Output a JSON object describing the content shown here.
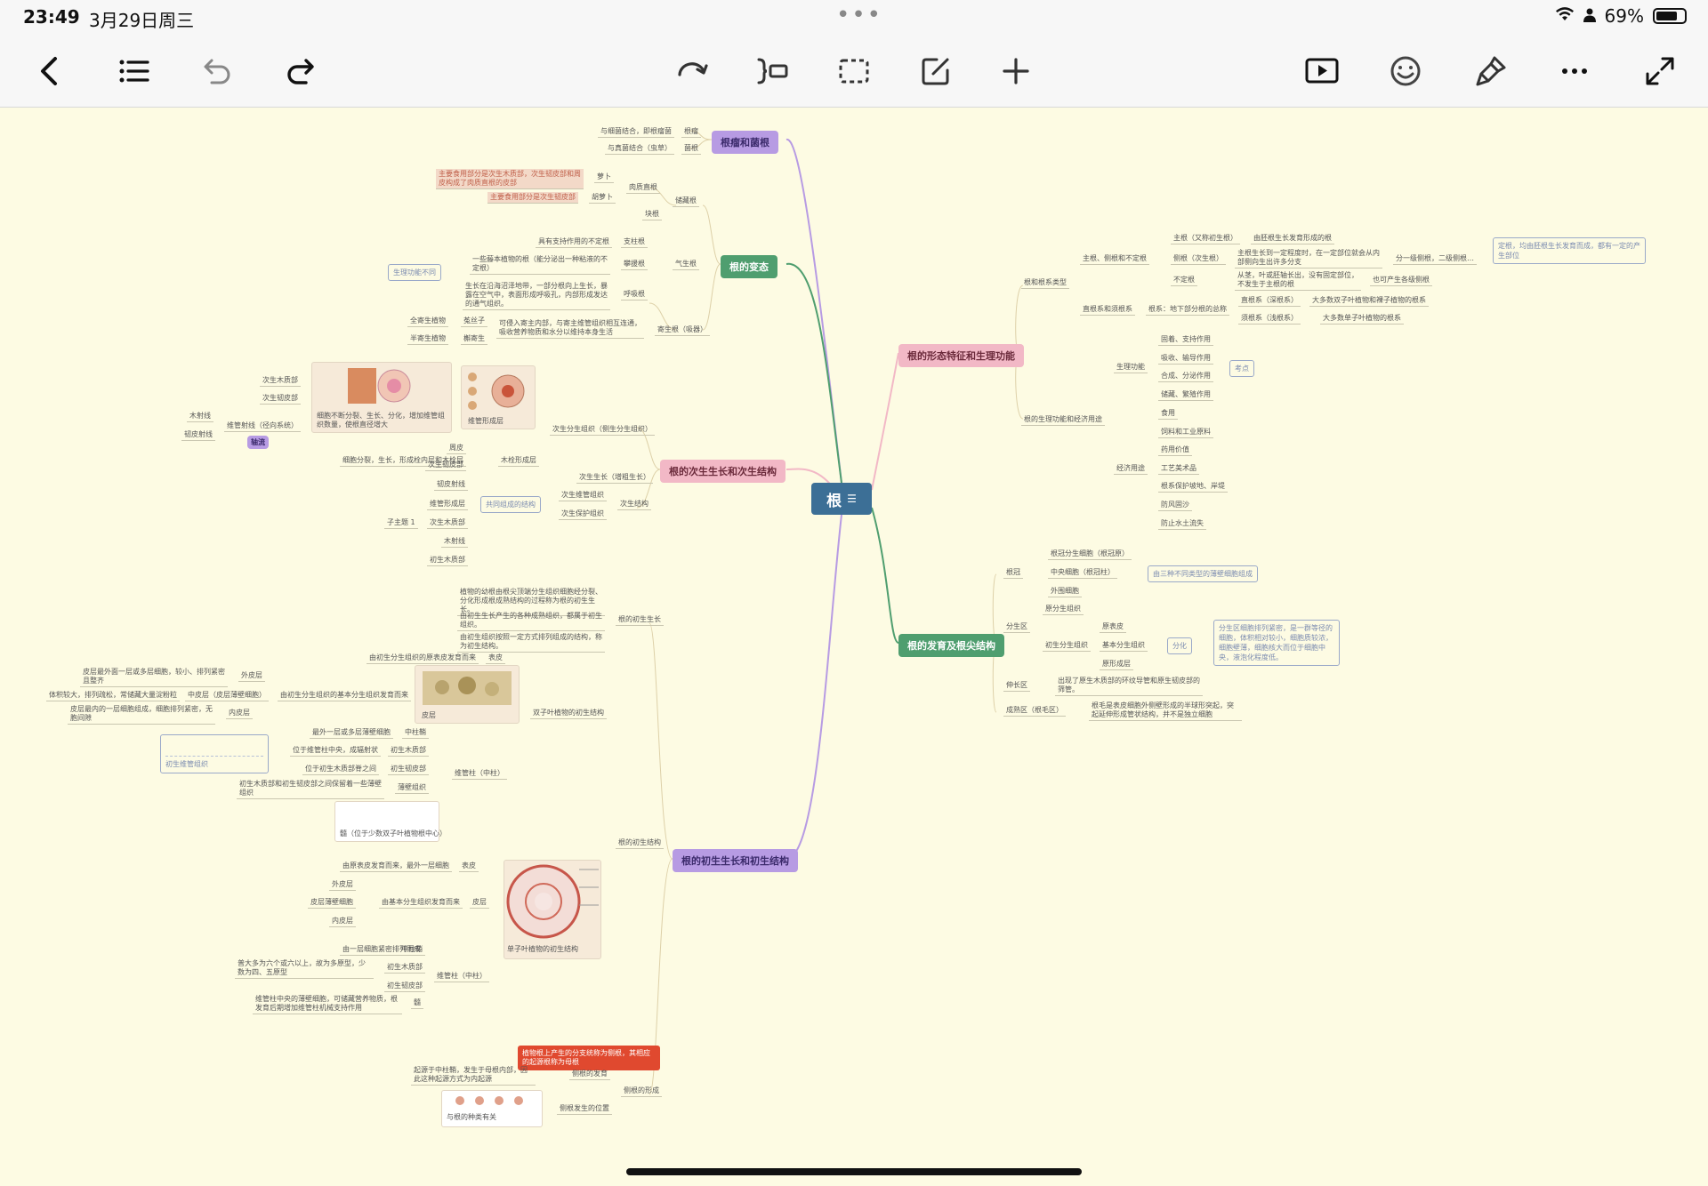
{
  "status": {
    "time": "23:49",
    "date": "3月29日周三",
    "battery": "69%",
    "battery_level": 0.69,
    "dots": "•••"
  },
  "toolbar": {
    "icons": [
      "back-icon",
      "outline-icon",
      "undo-icon",
      "redo-icon",
      "reflow-icon",
      "insert-child-icon",
      "select-box-icon",
      "edit-note-icon",
      "add-icon",
      "present-icon",
      "emoji-icon",
      "brush-icon",
      "more-icon",
      "fullscreen-icon"
    ]
  },
  "colors": {
    "root": "#3c6f96",
    "purple": "#b79be3",
    "green": "#4f9e6f",
    "pink": "#f2b8c6",
    "orange": "#e0492f"
  },
  "map": {
    "root": "根",
    "branches": {
      "b1": "根瘤和菌根",
      "b2": "根的变态",
      "b3": "根的次生生长和次生结构",
      "b4": "根的初生生长和初生结构",
      "b5": "根的形态特征和生理功能",
      "b6": "根的发育及根尖结构"
    },
    "b1_items": [
      "与细菌结合，即根瘤菌",
      "根瘤",
      "与真菌结合（虫草）",
      "菌根"
    ],
    "b2_items": {
      "a1": "主要食用部分是次生木质部，次生韧皮部和周皮构成了肉质直根的皮部",
      "a2": "萝卜",
      "a3": "主要食用部分是次生韧皮部",
      "a4": "胡萝卜",
      "a5": "肉质直根",
      "a6": "块根",
      "a7": "储藏根",
      "a8": "具有支持作用的不定根",
      "a9": "支柱根",
      "a10": "一些藤本植物的根（能分泌出一种粘液的不定根）",
      "a11": "攀援根",
      "a12": "生长在沿海沼泽地带，一部分根向上生长，暴露在空气中，表面形成呼吸孔，内部形成发达的通气组织。",
      "a13": "呼吸根",
      "a14": "气生根",
      "a15": "生理功能不同",
      "a16": "全寄生植物",
      "a17": "菟丝子",
      "a18": "半寄生植物",
      "a19": "槲寄生",
      "a20": "可侵入寄主内部，与寄主维管组织相互连通，吸收营养物质和水分以维持本身生活",
      "a21": "寄生根（吸器）"
    },
    "b3_items": {
      "c1": "次生木质部",
      "c2": "次生韧皮部",
      "c3": "木射线",
      "c4": "韧皮射线",
      "c5": "维管射线（径向系统）",
      "c6": "轴流",
      "c7": "细胞不断分裂、生长、分化，增加维管组织数量，使根直径增大",
      "c8": "维管形成层",
      "c9": "次生分生组织（侧生分生组织）",
      "c10": "周皮",
      "c11": "细胞分裂，生长，形成栓内层和木栓层",
      "c12": "木栓形成层",
      "c13": "次生韧皮部",
      "c14": "韧皮射线",
      "c15": "维管形成层",
      "c16": "子主题 1",
      "c17": "次生木质部",
      "c18": "木射线",
      "c19": "初生木质部",
      "c20": "共同组成的结构",
      "c21": "次生生长（增粗生长）",
      "c22": "次生维管组织",
      "c23": "次生保护组织",
      "c24": "次生结构"
    },
    "b4_items": {
      "d1": "植物的幼根由根尖顶端分生组织细胞经分裂、分化形成根成熟结构的过程称为根的初生生长。",
      "d2": "由初生生长产生的各种成熟组织，都属于初生组织。",
      "d3": "由初生组织按照一定方式排列组成的结构，称为初生结构。",
      "d4": "根的初生生长",
      "d5": "由初生分生组织的原表皮发育而来",
      "d6": "表皮",
      "d7": "皮层最外面一层或多层细胞，较小、排列紧密且整齐",
      "d8": "外皮层",
      "d9": "体积较大，排列疏松，常储藏大量淀粉粒",
      "d10": "中皮层（皮层薄壁细胞）",
      "d11": "由初生分生组织的基本分生组织发育而来",
      "d12": "皮层最内的一层细胞组成，细胞排列紧密，无胞间隙",
      "d13": "内皮层",
      "d14": "皮层",
      "d15": "双子叶植物的初生结构",
      "d16": "最外一层或多层薄壁细胞",
      "d17": "中柱鞘",
      "d18": "位于维管柱中央，成辐射状",
      "d19": "初生木质部",
      "d20": "位于初生木质部脊之间",
      "d21": "初生韧皮部",
      "d22": "初生木质部和初生韧皮部之间保留着一些薄壁组织",
      "d23": "薄壁组织",
      "d24": "维管柱（中柱）",
      "d25": "初生维管组织",
      "d26": "髓（位于少数双子叶植物根中心）",
      "d27": "根的初生结构",
      "d28": "由原表皮发育而来，最外一层细胞",
      "d29": "表皮",
      "d30": "外皮层",
      "d31": "皮层薄壁细胞",
      "d32": "内皮层",
      "d33": "由基本分生组织发育而来",
      "d34": "皮层",
      "d35": "由一层细胞紧密排列而成",
      "d36": "中柱鞘",
      "d37": "普大多为六个或六以上，故为多原型，少数为四、五原型",
      "d38": "初生木质部",
      "d39": "初生韧皮部",
      "d40": "维管柱中央的薄壁细胞，可储藏营养物质，根发育后期增加维管柱机械支持作用",
      "d41": "髓",
      "d42": "维管柱（中柱）",
      "d43": "单子叶植物的初生结构",
      "d44": "植物根上产生的分支统称为侧根，其相应的起源根称为母根",
      "d45": "起源于中柱鞘，发生于母根内部，因此这种起源方式为内起源",
      "d46": "侧根的发育",
      "d47": "与根的种类有关",
      "d48": "侧根发生的位置",
      "d49": "侧根的形成",
      "d50": "皮层"
    },
    "b5_items": {
      "e1": "主根（又称初生根）",
      "e2": "由胚根生长发育形成的根",
      "e3": "侧根（次生根）",
      "e4": "主根生长到一定程度时，在一定部位就会从内部侧向生出许多分支",
      "e5": "分一级侧根，二级侧根…",
      "e6": "定根，均由胚根生长发育而成，都有一定的产生部位",
      "e7": "不定根",
      "e8": "从茎，叶或胚轴长出，没有固定部位，不发生于主根的根",
      "e9": "也可产生各级侧根",
      "e10": "主根、侧根和不定根",
      "e11": "根和根系类型",
      "e12": "直根系（深根系）",
      "e13": "大多数双子叶植物和裸子植物的根系",
      "e14": "须根系（浅根系）",
      "e15": "大多数单子叶植物的根系",
      "e16": "根系：地下部分根的总称",
      "e17": "直根系和须根系",
      "e18": "固着、支持作用",
      "e19": "吸收、输导作用",
      "e20": "合成、分泌作用",
      "e21": "储藏、繁殖作用",
      "e22": "考点",
      "e23": "生理功能",
      "e24": "食用",
      "e25": "饲料和工业原料",
      "e26": "药用价值",
      "e27": "工艺美术品",
      "e28": "根系保护坡地、岸堤",
      "e29": "防风固沙",
      "e30": "防止水土流失",
      "e31": "经济用途",
      "e32": "根的生理功能和经济用途"
    },
    "b6_items": {
      "f1": "根冠分生细胞（根冠原）",
      "f2": "中央细胞（根冠柱）",
      "f3": "外围细胞",
      "f4": "根冠",
      "f5": "由三种不同类型的薄壁细胞组成",
      "f6": "原分生组织",
      "f7": "原表皮",
      "f8": "基本分生组织",
      "f9": "原形成层",
      "f10": "初生分生组织",
      "f11": "分化",
      "f12": "分生区",
      "f13": "分生区细胞排列紧密，是一群等径的细胞，体积相对较小，细胞质较浓，细胞壁薄，细胞核大而位于细胞中央，液泡化程度低。",
      "f14": "伸长区",
      "f15": "出现了原生木质部的环纹导管和原生韧皮部的筛管。",
      "f16": "成熟区（根毛区）",
      "f17": "根毛是表皮细胞外侧壁形成的半球形突起，突起延伸形成管状结构，并不是独立细胞"
    },
    "pic_labels": {
      "p1": "维管形成层",
      "p2": "皮层",
      "p3": "单子叶植物的初生结构",
      "p4": "与根的种类有关"
    }
  }
}
